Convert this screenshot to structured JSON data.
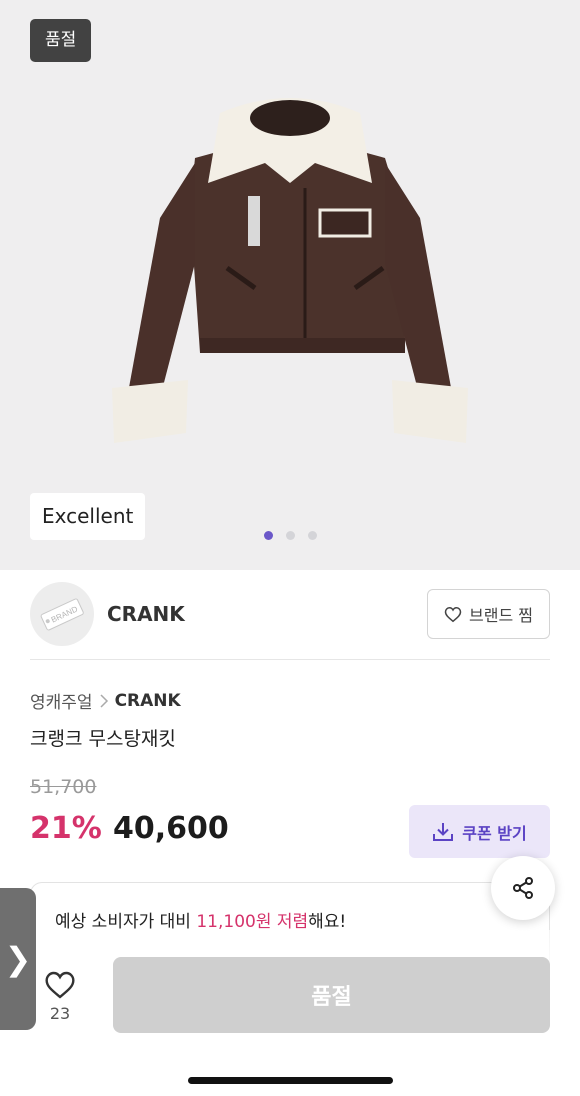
{
  "hero": {
    "soldout_badge": "품절",
    "condition_badge": "Excellent",
    "image_icon": "jacket-photo",
    "dots": [
      true,
      false,
      false
    ]
  },
  "brand": {
    "logo_label": "BRAND",
    "name": "CRANK",
    "favorite_label": "브랜드 찜",
    "favorite_icon": "heart-outline-icon"
  },
  "product": {
    "breadcrumb_category": "영캐주얼",
    "breadcrumb_brand": "CRANK",
    "title": "크랭크 무스탕재킷",
    "original_price": "51,700",
    "discount": "21%",
    "sale_price": "40,600",
    "coupon_label": "쿠폰 받기",
    "coupon_icon": "download-icon"
  },
  "saving": {
    "prefix": "예상 소비자가 대비 ",
    "highlight": "11,100원 저렴",
    "suffix": "해요!"
  },
  "bottom_bar": {
    "like_count": "23",
    "buy_label": "품절",
    "side_tab_glyph": "❯"
  },
  "colors": {
    "accent": "#d5336b",
    "brand_purple": "#5b43c4",
    "coupon_bg": "#ebe6f9",
    "disabled_button": "#cfcfcf",
    "hero_bg": "#efeeef"
  }
}
